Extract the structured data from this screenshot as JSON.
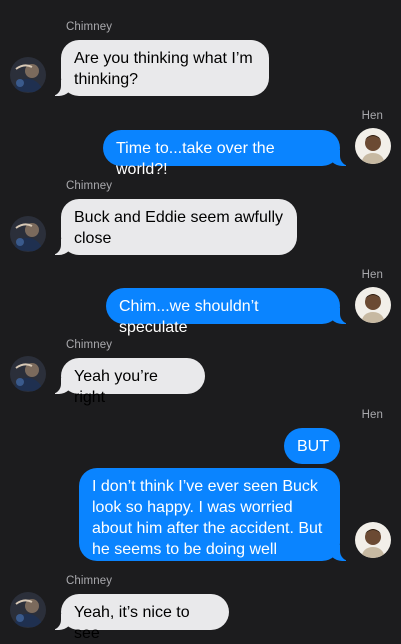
{
  "conversation": {
    "messages": [
      {
        "sender": "Chimney",
        "direction": "incoming",
        "text": "Are you thinking what I’m thinking?",
        "avatar_icon": "chimney-avatar-icon"
      },
      {
        "sender": "Hen",
        "direction": "outgoing",
        "text": "Time to...take over the world?!",
        "avatar_icon": "hen-avatar-icon"
      },
      {
        "sender": "Chimney",
        "direction": "incoming",
        "text": "Buck and Eddie seem awfully close",
        "avatar_icon": "chimney-avatar-icon"
      },
      {
        "sender": "Hen",
        "direction": "outgoing",
        "text": "Chim...we shouldn’t speculate",
        "avatar_icon": "hen-avatar-icon"
      },
      {
        "sender": "Chimney",
        "direction": "incoming",
        "text": "Yeah you’re right",
        "avatar_icon": "chimney-avatar-icon"
      },
      {
        "sender": "Hen",
        "direction": "outgoing",
        "text": "BUT",
        "avatar_icon": "hen-avatar-icon"
      },
      {
        "sender": "Hen",
        "direction": "outgoing",
        "text": "I don’t think I’ve ever seen Buck look so happy. I was worried about him after the accident. But he seems to be doing well",
        "avatar_icon": "hen-avatar-icon"
      },
      {
        "sender": "Chimney",
        "direction": "incoming",
        "text": "Yeah, it’s nice to see",
        "avatar_icon": "chimney-avatar-icon"
      }
    ]
  },
  "colors": {
    "background": "#1c1c1e",
    "incoming_bubble": "#e9e9eb",
    "outgoing_bubble": "#0a84ff",
    "sender_label": "#a9a9ad"
  }
}
